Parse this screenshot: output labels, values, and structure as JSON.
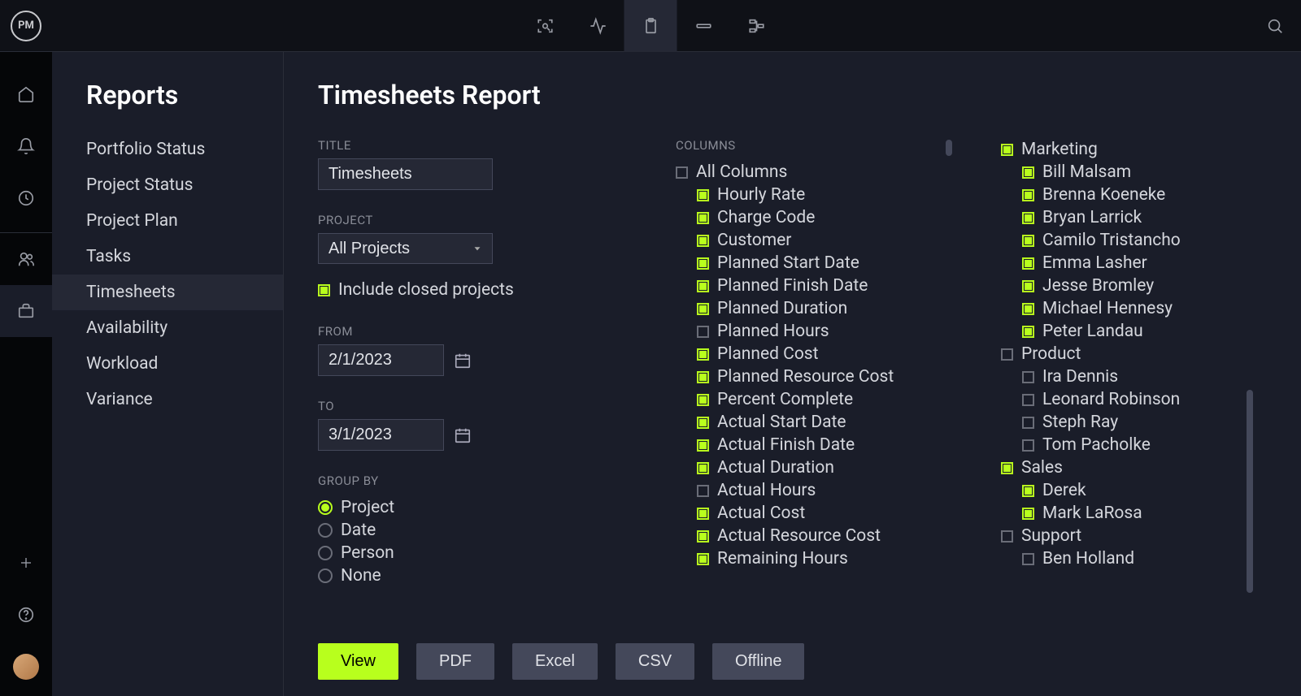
{
  "logo": "PM",
  "reports": {
    "title": "Reports",
    "items": [
      {
        "label": "Portfolio Status",
        "active": false
      },
      {
        "label": "Project Status",
        "active": false
      },
      {
        "label": "Project Plan",
        "active": false
      },
      {
        "label": "Tasks",
        "active": false
      },
      {
        "label": "Timesheets",
        "active": true
      },
      {
        "label": "Availability",
        "active": false
      },
      {
        "label": "Workload",
        "active": false
      },
      {
        "label": "Variance",
        "active": false
      }
    ]
  },
  "page": {
    "title": "Timesheets Report",
    "title_label": "TITLE",
    "title_value": "Timesheets",
    "project_label": "PROJECT",
    "project_value": "All Projects",
    "include_closed_label": "Include closed projects",
    "include_closed_checked": true,
    "from_label": "FROM",
    "from_value": "2/1/2023",
    "to_label": "TO",
    "to_value": "3/1/2023",
    "group_by_label": "GROUP BY",
    "group_by_options": [
      {
        "label": "Project",
        "checked": true
      },
      {
        "label": "Date",
        "checked": false
      },
      {
        "label": "Person",
        "checked": false
      },
      {
        "label": "None",
        "checked": false
      }
    ],
    "columns_label": "COLUMNS",
    "all_columns_label": "All Columns",
    "all_columns_checked": false,
    "columns": [
      {
        "label": "Hourly Rate",
        "checked": true
      },
      {
        "label": "Charge Code",
        "checked": true
      },
      {
        "label": "Customer",
        "checked": true
      },
      {
        "label": "Planned Start Date",
        "checked": true
      },
      {
        "label": "Planned Finish Date",
        "checked": true
      },
      {
        "label": "Planned Duration",
        "checked": true
      },
      {
        "label": "Planned Hours",
        "checked": false
      },
      {
        "label": "Planned Cost",
        "checked": true
      },
      {
        "label": "Planned Resource Cost",
        "checked": true
      },
      {
        "label": "Percent Complete",
        "checked": true
      },
      {
        "label": "Actual Start Date",
        "checked": true
      },
      {
        "label": "Actual Finish Date",
        "checked": true
      },
      {
        "label": "Actual Duration",
        "checked": true
      },
      {
        "label": "Actual Hours",
        "checked": false
      },
      {
        "label": "Actual Cost",
        "checked": true
      },
      {
        "label": "Actual Resource Cost",
        "checked": true
      },
      {
        "label": "Remaining Hours",
        "checked": true
      }
    ],
    "teams": [
      {
        "label": "Marketing",
        "checked": true,
        "members": [
          {
            "label": "Bill Malsam",
            "checked": true
          },
          {
            "label": "Brenna Koeneke",
            "checked": true
          },
          {
            "label": "Bryan Larrick",
            "checked": true
          },
          {
            "label": "Camilo Tristancho",
            "checked": true
          },
          {
            "label": "Emma Lasher",
            "checked": true
          },
          {
            "label": "Jesse Bromley",
            "checked": true
          },
          {
            "label": "Michael Hennesy",
            "checked": true
          },
          {
            "label": "Peter Landau",
            "checked": true
          }
        ]
      },
      {
        "label": "Product",
        "checked": false,
        "members": [
          {
            "label": "Ira Dennis",
            "checked": false
          },
          {
            "label": "Leonard Robinson",
            "checked": false
          },
          {
            "label": "Steph Ray",
            "checked": false
          },
          {
            "label": "Tom Pacholke",
            "checked": false
          }
        ]
      },
      {
        "label": "Sales",
        "checked": true,
        "members": [
          {
            "label": "Derek",
            "checked": true
          },
          {
            "label": "Mark LaRosa",
            "checked": true
          }
        ]
      },
      {
        "label": "Support",
        "checked": false,
        "members": [
          {
            "label": "Ben Holland",
            "checked": false
          }
        ]
      }
    ],
    "buttons": {
      "view": "View",
      "pdf": "PDF",
      "excel": "Excel",
      "csv": "CSV",
      "offline": "Offline"
    }
  }
}
